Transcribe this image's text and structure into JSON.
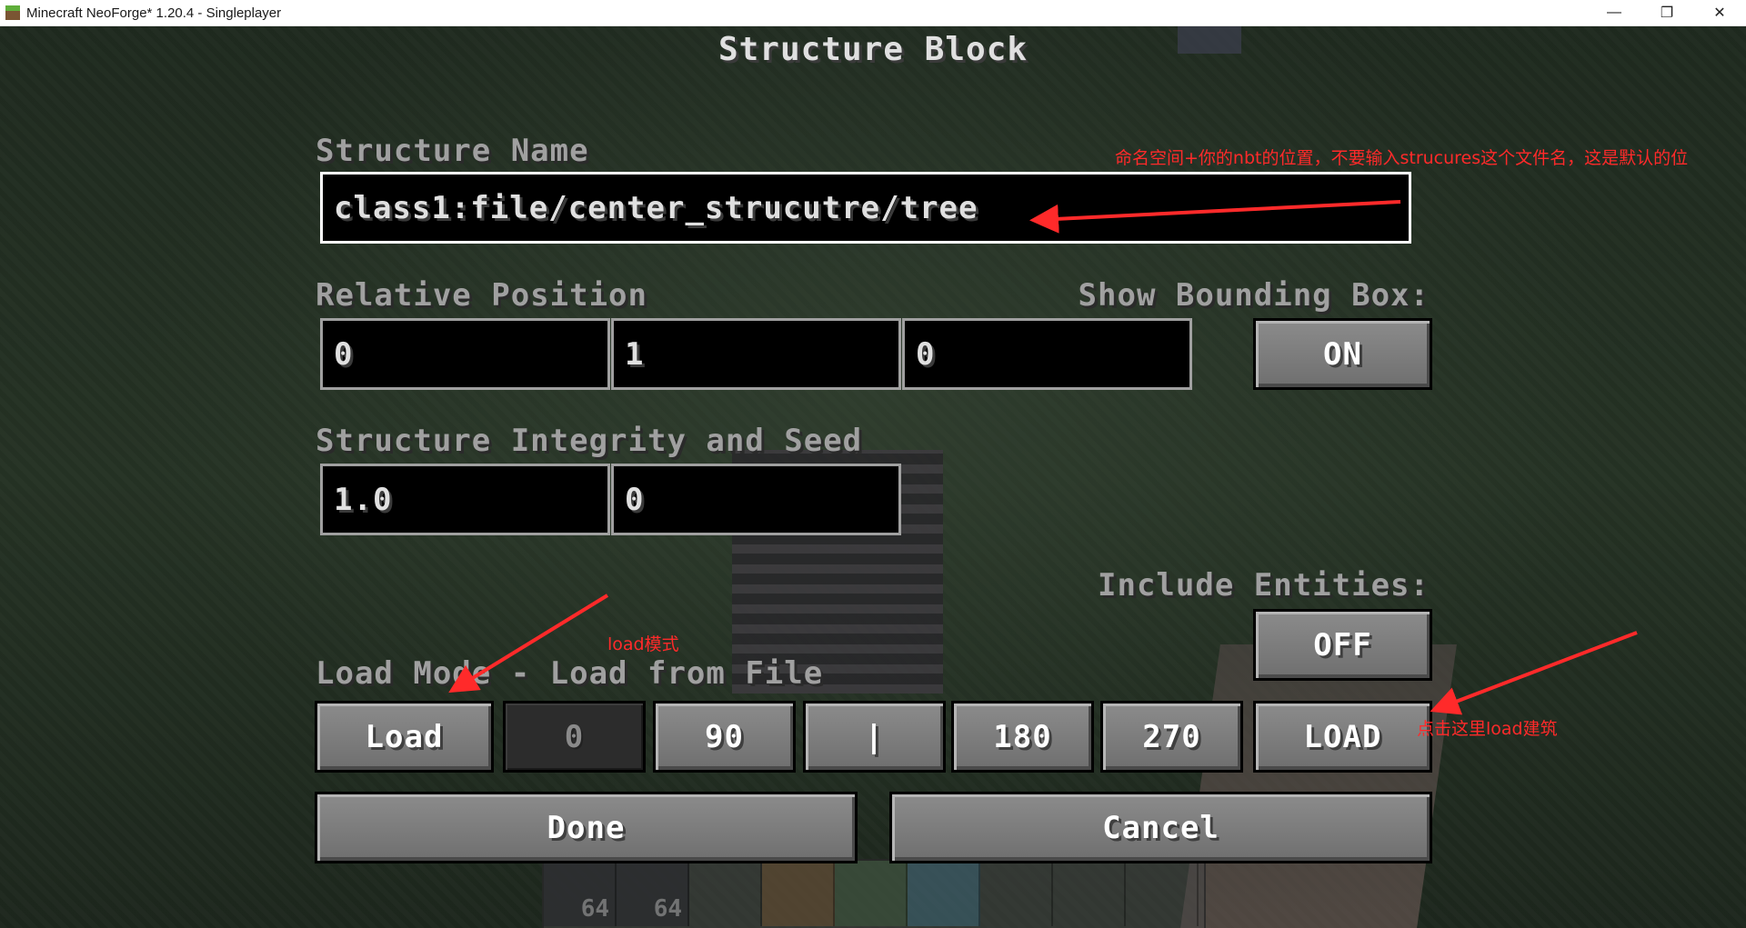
{
  "window": {
    "title": "Minecraft NeoForge* 1.20.4 - Singleplayer",
    "controls": [
      "minimize",
      "maximize",
      "close"
    ]
  },
  "screen": {
    "title": "Structure Block",
    "structure_name_label": "Structure Name",
    "structure_name_value": "class1:file/center_strucutre/tree",
    "relative_position_label": "Relative Position",
    "relative_position": [
      "0",
      "1",
      "0"
    ],
    "show_bounding_box_label": "Show Bounding Box:",
    "show_bounding_box_value": "ON",
    "integrity_seed_label": "Structure Integrity and Seed",
    "integrity": "1.0",
    "seed": "0",
    "include_entities_label": "Include Entities:",
    "include_entities_value": "OFF",
    "load_mode_label": "Load Mode - Load from File",
    "mode_button": "Load",
    "rotation_buttons": [
      "0",
      "90",
      "|",
      "180",
      "270"
    ],
    "action_button": "LOAD",
    "done_button": "Done",
    "cancel_button": "Cancel"
  },
  "hotbar": {
    "counts": [
      "64",
      "64"
    ]
  },
  "annotations": {
    "name_note": "命名空间+你的nbt的位置，不要输入strucures这个文件名，这是默认的位",
    "mode_note": "load模式",
    "load_note": "点击这里load建筑",
    "color": "#ff2a2a"
  }
}
